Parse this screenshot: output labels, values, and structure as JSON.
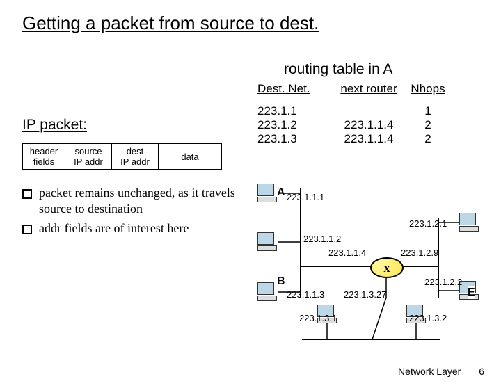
{
  "title": "Getting a packet from source to dest.",
  "subtitle": "routing table in A",
  "table": {
    "headers": {
      "dest": "Dest. Net.",
      "next": "next router",
      "nhops": "Nhops"
    },
    "rows": [
      {
        "dest": "223.1.1",
        "next": "",
        "nhops": "1"
      },
      {
        "dest": "223.1.2",
        "next": "223.1.1.4",
        "nhops": "2"
      },
      {
        "dest": "223.1.3",
        "next": "223.1.1.4",
        "nhops": "2"
      }
    ]
  },
  "ip_label": "IP packet:",
  "packet": {
    "header_top": "header",
    "header_bot": "fields",
    "src_top": "source",
    "src_bot": "IP addr",
    "dst_top": "dest",
    "dst_bot": "IP addr",
    "data": "data"
  },
  "bullets": [
    "packet remains unchanged, as it travels source to destination",
    "addr fields are of interest here"
  ],
  "net": {
    "labels": {
      "A": "A",
      "B": "B",
      "E": "E",
      "a_ip": "223.1.1.1",
      "ip_112": "223.1.1.2",
      "ip_113": "223.1.1.3",
      "ip_114": "223.1.1.4",
      "ip_121": "223.1.2.1",
      "ip_129": "223.1.2.9",
      "ip_122": "223.1.2.2",
      "ip_1327": "223.1.3.27",
      "ip_131": "223.1.3.1",
      "ip_132": "223.1.3.2"
    },
    "router_mark": "x"
  },
  "footer": {
    "text": "Network Layer",
    "page": "6"
  }
}
